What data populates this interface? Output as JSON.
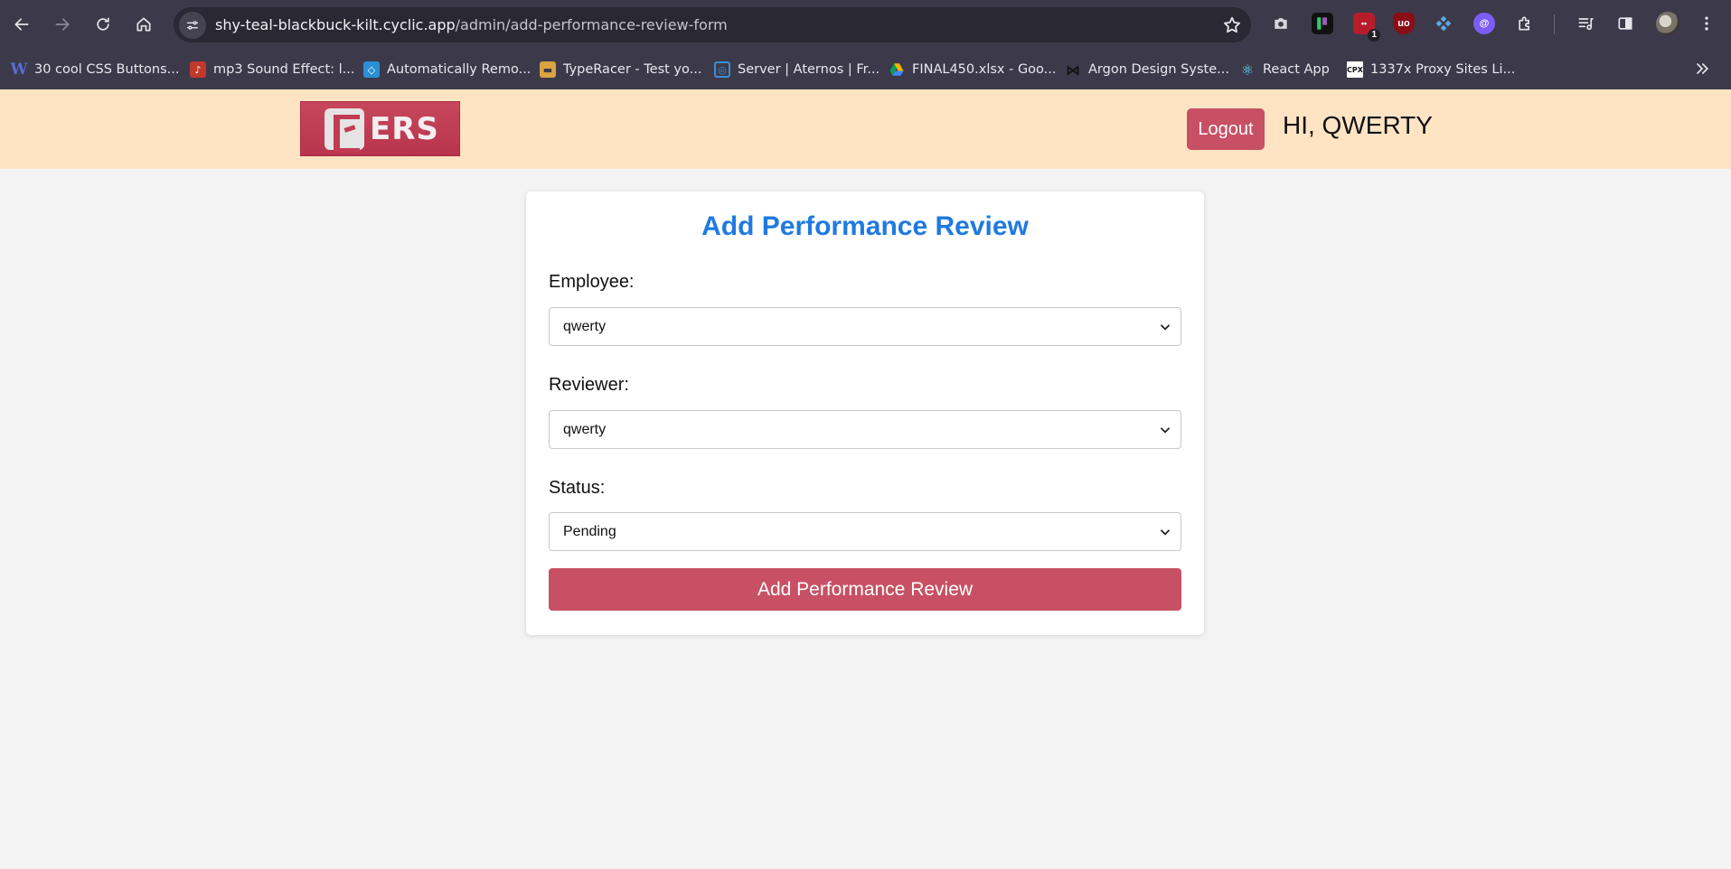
{
  "browser": {
    "url_host": "shy-teal-blackbuck-kilt.cyclic.app",
    "url_path": "/admin/add-performance-review-form",
    "extension_badge": "1",
    "bookmarks": [
      {
        "label": "30 cool CSS Buttons...",
        "icon": "w-logo-icon",
        "color": "#5b6bd6"
      },
      {
        "label": "mp3 Sound Effect: l...",
        "icon": "music-note-icon",
        "color": "#c0392b"
      },
      {
        "label": "Automatically Remo...",
        "icon": "remove-bg-icon",
        "color": "#2b8fd6"
      },
      {
        "label": "TypeRacer - Test yo...",
        "icon": "typeracer-icon",
        "color": "#d9a441"
      },
      {
        "label": "Server | Aternos | Fr...",
        "icon": "aternos-icon",
        "color": "#3a8fd6"
      },
      {
        "label": "FINAL450.xlsx - Goo...",
        "icon": "google-drive-icon",
        "color": "#f4b400"
      },
      {
        "label": "Argon Design Syste...",
        "icon": "bowtie-icon",
        "color": "#111111"
      },
      {
        "label": "React App",
        "icon": "react-icon",
        "color": "#61dafb"
      },
      {
        "label": "1337x Proxy Sites Li...",
        "icon": "cpx-icon",
        "color": "#ffffff"
      }
    ]
  },
  "header": {
    "logo_text": "ERS",
    "logout_label": "Logout",
    "greeting": "HI, QWERTY"
  },
  "form": {
    "title": "Add Performance Review",
    "employee_label": "Employee:",
    "employee_value": "qwerty",
    "reviewer_label": "Reviewer:",
    "reviewer_value": "qwerty",
    "status_label": "Status:",
    "status_value": "Pending",
    "submit_label": "Add Performance Review"
  },
  "colors": {
    "header_bg": "#ffe4c4",
    "accent": "#c85064",
    "title": "#1f7ae0",
    "page_bg": "#f3f3f3"
  }
}
